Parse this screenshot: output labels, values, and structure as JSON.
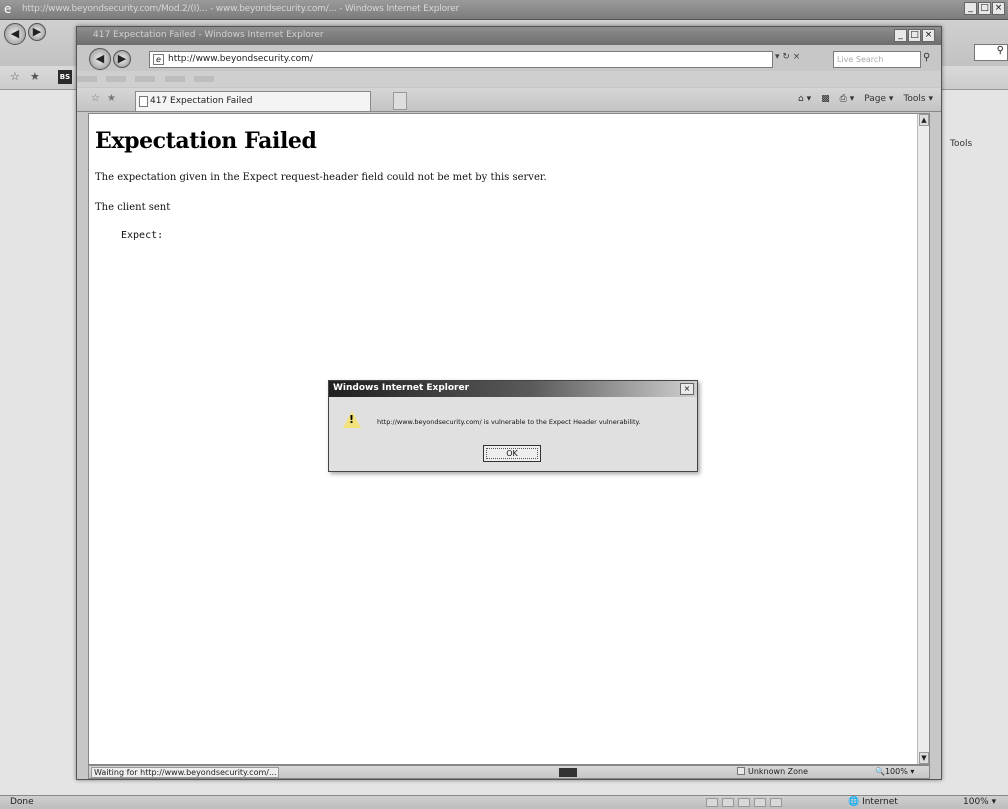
{
  "outer_window": {
    "title": "http://www.beyondsecurity.com/Mod.2/(I)... - www.beyondsecurity.com/... - Windows Internet Explorer",
    "tools_label": "Tools",
    "status_text": "Done",
    "zone_label": "Internet",
    "zoom_label": "100%"
  },
  "inner_window": {
    "title": "417 Expectation Failed - Windows Internet Explorer",
    "address_url": "http://www.beyondsecurity.com/",
    "search_placeholder": "Live Search",
    "tab_label": "417 Expectation Failed",
    "cmd": {
      "page_label": "Page",
      "tools_label": "Tools"
    },
    "status": {
      "loading_text": "Waiting for http://www.beyondsecurity.com/...",
      "zone_label": "Unknown Zone",
      "zoom_label": "100%"
    }
  },
  "page": {
    "heading": "Expectation Failed",
    "paragraph1": "The expectation given in the Expect request-header field could not be met by this server.",
    "paragraph2": "The client sent",
    "pre_text": "Expect:"
  },
  "dialog": {
    "title": "Windows Internet Explorer",
    "message": "http://www.beyondsecurity.com/ is vulnerable to the Expect Header vulnerability.",
    "ok_label": "OK"
  }
}
